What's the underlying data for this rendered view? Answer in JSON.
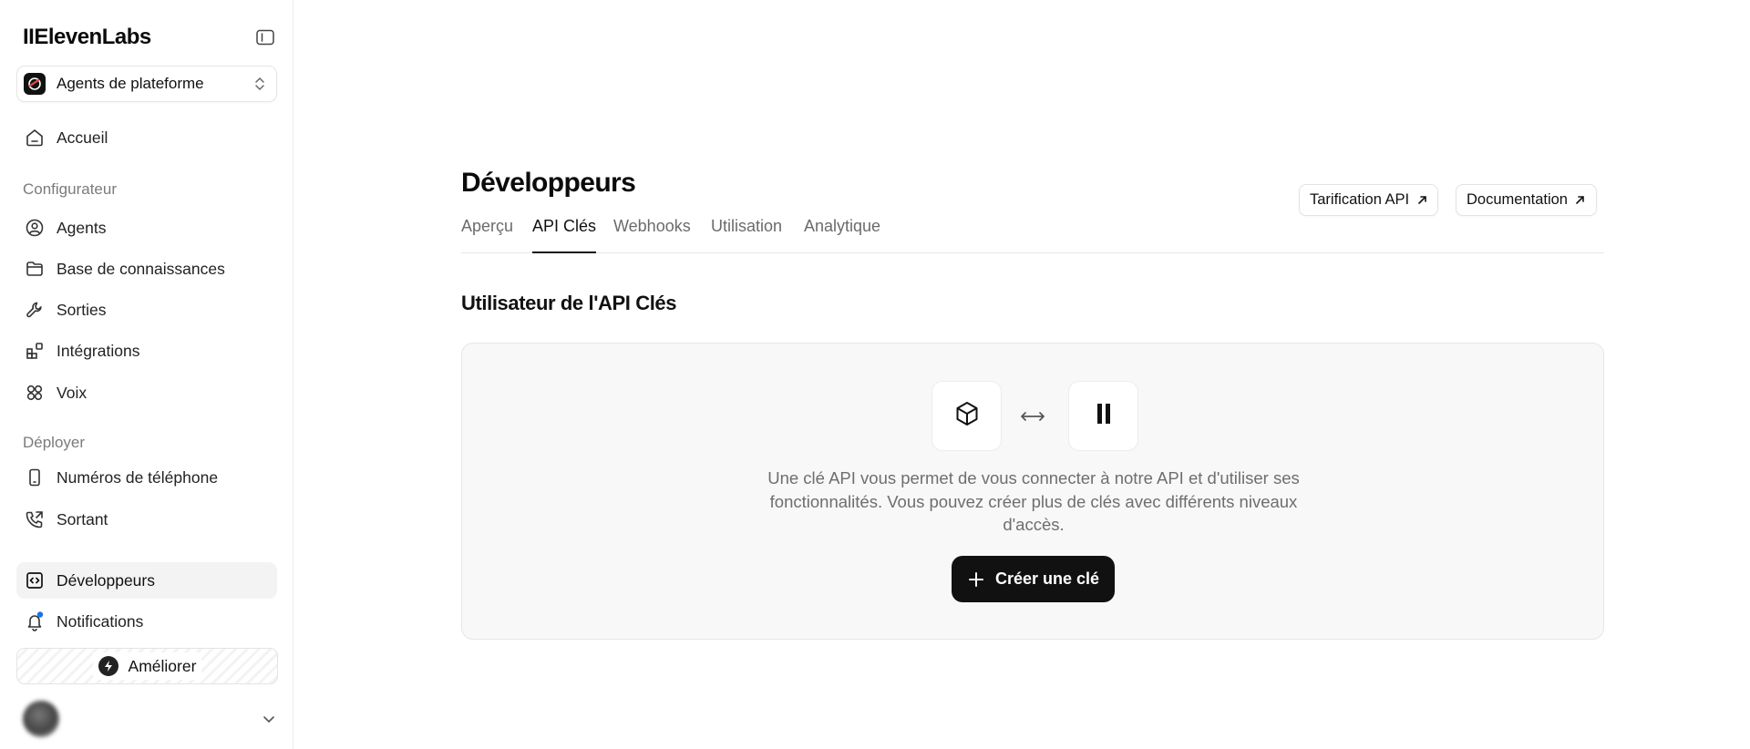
{
  "app": {
    "logo": "IIElevenLabs"
  },
  "workspace": {
    "label": "Agents de plateforme"
  },
  "sidebar": {
    "home": "Accueil",
    "section_configurator": "Configurateur",
    "agents": "Agents",
    "knowledge_base": "Base de connaissances",
    "tools": "Sorties",
    "integrations": "Intégrations",
    "voices": "Voix",
    "section_deploy": "Déployer",
    "phone_numbers": "Numéros de téléphone",
    "outbound": "Sortant",
    "developers": "Développeurs",
    "notifications": "Notifications",
    "upgrade": "Améliorer"
  },
  "main": {
    "title": "Développeurs",
    "pricing_button": "Tarification API",
    "docs_button": "Documentation",
    "tabs": [
      "Aperçu",
      "API Clés",
      "Webhooks",
      "Utilisation",
      "Analytique"
    ],
    "active_tab": "API Clés",
    "section_title": "Utilisateur de l'API Clés",
    "empty_state": {
      "description": "Une clé API vous permet de vous connecter à notre API et d'utiliser ses fonctionnalités. Vous pouvez créer plus de clés avec différents niveaux d'accès.",
      "create_button": "Créer une clé"
    }
  },
  "colors": {
    "accent": "#111111",
    "notification_dot": "#1a73e8",
    "card_bg": "#f8f8f8"
  }
}
